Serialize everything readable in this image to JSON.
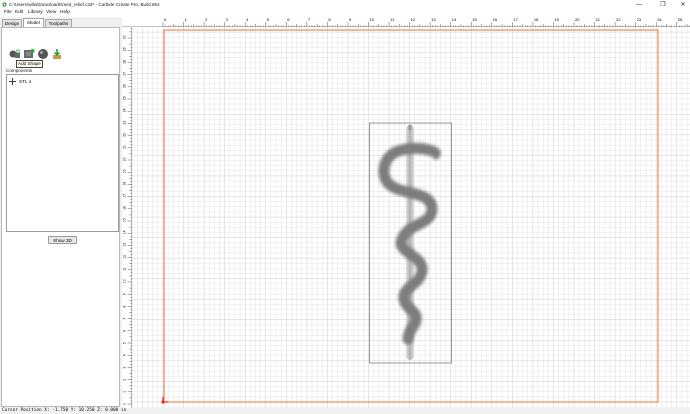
{
  "window": {
    "title": "C:\\Users\\willa\\Downloads\\med_relief.c2d* - Carbide Create Pro, Build 854",
    "minimize_glyph": "—",
    "maximize_glyph": "❐",
    "close_glyph": "✕"
  },
  "menu": [
    "File",
    "Edit",
    "Library",
    "View",
    "Help"
  ],
  "tabs": [
    "Design",
    "Model",
    "Toolpaths"
  ],
  "active_tab": "Model",
  "toolbar": {
    "tooltip": "Add Shape",
    "tools": [
      "add-shape-icon",
      "add-component-icon",
      "sphere-icon",
      "import-model-icon"
    ]
  },
  "components": {
    "label": "Components",
    "items": [
      {
        "icon": "plus-icon",
        "name": "STL 4"
      }
    ]
  },
  "show3d_label": "Show 3D",
  "rulers": {
    "x_ticks": [
      "0",
      "1",
      "2",
      "3",
      "4",
      "5",
      "6",
      "7",
      "8",
      "9",
      "10",
      "11",
      "12",
      "13",
      "14",
      "15",
      "16",
      "17",
      "18",
      "19",
      "20",
      "21",
      "22",
      "23",
      "24",
      "25"
    ],
    "y_ticks": [
      "30",
      "29",
      "28",
      "27",
      "26",
      "25",
      "24",
      "23",
      "22",
      "21",
      "20",
      "19",
      "18",
      "17",
      "16",
      "15",
      "14",
      "13",
      "12",
      "11",
      "10",
      "9",
      "8",
      "7",
      "6",
      "5",
      "4",
      "3",
      "2",
      "1",
      "0"
    ]
  },
  "status": "Cursor Position X: -1.750 Y: 10.250 Z: 0.000 in",
  "colors": {
    "stock_border": "#e8733a",
    "grid_minor": "#e4e4e4",
    "grid_major": "#cfcfcf",
    "origin": "#ff2020",
    "snake_shade": "#7d7d7d"
  }
}
